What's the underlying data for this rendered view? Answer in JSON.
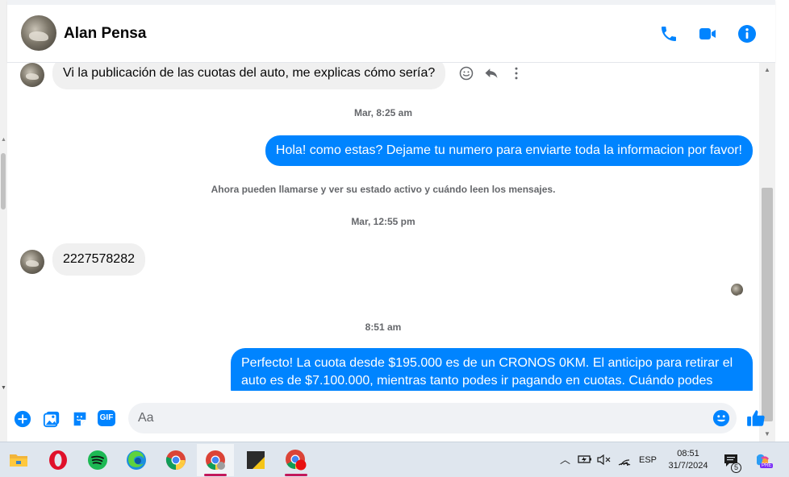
{
  "header": {
    "contact_name": "Alan Pensa",
    "icons": [
      "phone-icon",
      "video-camera-icon",
      "info-icon"
    ],
    "accent_color": "#0084ff"
  },
  "messages": {
    "m1_text": "Vi la publicación de las cuotas del auto, me explicas cómo sería?",
    "ts1": "Mar, 8:25 am",
    "m2_text": "Hola! como estas? Dejame tu numero para enviarte toda la informacion por favor!",
    "notice": "Ahora pueden llamarse y ver su estado activo y cuándo leen los mensajes.",
    "ts2": "Mar, 12:55 pm",
    "m3_text": "2227578282",
    "ts3": "8:51 am",
    "m4_text": "Perfecto! La cuota desde $195.000 es de un CRONOS 0KM. El anticipo para retirar el auto es de $7.100.000, mientras tanto podes ir pagando en cuotas. Cuándo podes"
  },
  "composer": {
    "placeholder": "Aa",
    "icons": [
      "plus-icon",
      "photo-icon",
      "sticker-icon",
      "gif-icon",
      "emoji-icon",
      "thumbs-up-icon"
    ],
    "gif_label": "GIF"
  },
  "taskbar": {
    "apps": [
      "file-explorer-icon",
      "opera-icon",
      "spotify-icon",
      "edge-icon",
      "chrome-icon",
      "chrome-profile-icon",
      "sticky-app-icon",
      "chrome-notify-icon"
    ],
    "language": "ESP",
    "time": "08:51",
    "date": "31/7/2024",
    "notification_count": "5"
  }
}
